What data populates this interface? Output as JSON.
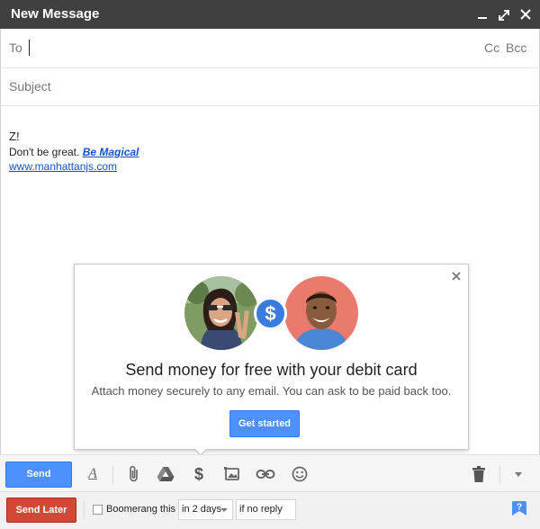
{
  "window": {
    "title": "New Message",
    "controls": [
      "minimize-icon",
      "expand-icon",
      "close-icon"
    ]
  },
  "compose": {
    "to_label": "To",
    "to_value": "",
    "cc_label": "Cc",
    "bcc_label": "Bcc",
    "subject_placeholder": "Subject",
    "subject_value": ""
  },
  "body": {
    "greeting": "Z!",
    "line_prefix": "Don't be great.",
    "line_link": "Be Magical",
    "website": "www.manhattanjs.com"
  },
  "promo": {
    "title": "Send money for free with your debit card",
    "subtitle": "Attach money securely to any email. You can ask to be paid back too.",
    "button": "Get started",
    "badge_symbol": "$",
    "accent": "#4d90fe"
  },
  "toolbar": {
    "send_label": "Send",
    "format_glyph": "A",
    "money_glyph": "$",
    "icons": [
      "formatting-icon",
      "attach-icon",
      "drive-icon",
      "money-icon",
      "photo-icon",
      "link-icon",
      "emoji-icon",
      "trash-icon",
      "more-options-icon"
    ]
  },
  "boomerang": {
    "send_later_label": "Send Later",
    "checkbox_label": "Boomerang this",
    "checked": false,
    "delay_value": "in 2 days",
    "condition_value": "if no reply",
    "send_later_color": "#d14836"
  }
}
